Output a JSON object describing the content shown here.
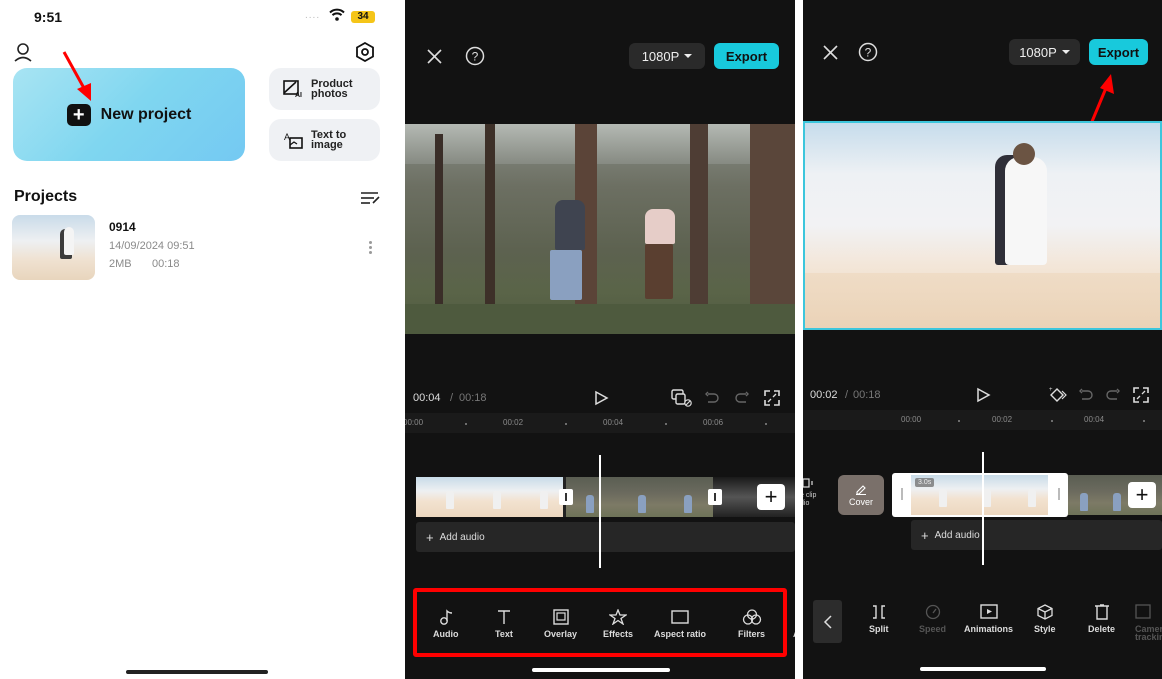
{
  "home": {
    "status_bar": {
      "time": "9:51",
      "signal": "....",
      "battery": "34"
    },
    "new_project_label": "New project",
    "side_cards": [
      {
        "label_line1": "Product",
        "label_line2": "photos",
        "icon": "ai-image-icon"
      },
      {
        "label_line1": "Text to",
        "label_line2": "image",
        "icon": "text-to-image-icon"
      }
    ],
    "projects_title": "Projects",
    "projects": [
      {
        "name": "0914",
        "date": "14/09/2024 09:51",
        "size": "2MB",
        "duration": "00:18"
      }
    ]
  },
  "editor": {
    "resolution": "1080P",
    "export_label": "Export",
    "current_time": "00:04",
    "separator": "/",
    "total_time": "00:18",
    "ruler_ticks": [
      "00:00",
      "00:02",
      "00:04",
      "00:06"
    ],
    "add_audio_label": "Add audio",
    "toolbar": [
      {
        "label": "Audio",
        "icon": "music-note-icon"
      },
      {
        "label": "Text",
        "icon": "text-icon"
      },
      {
        "label": "Overlay",
        "icon": "overlay-icon"
      },
      {
        "label": "Effects",
        "icon": "effects-star-icon"
      },
      {
        "label": "Aspect ratio",
        "icon": "aspect-ratio-icon"
      },
      {
        "label": "Filters",
        "icon": "filters-icon"
      },
      {
        "label": "A",
        "icon": ""
      }
    ]
  },
  "clip_editor": {
    "resolution": "1080P",
    "export_label": "Export",
    "current_time": "00:02",
    "separator": "/",
    "total_time": "00:18",
    "ruler_ticks": [
      "00:00",
      "00:02",
      "00:04"
    ],
    "mute_label_line1": "e clip",
    "mute_label_line2": "dio",
    "cover_label": "Cover",
    "clip_duration_badge": "3.0s",
    "add_audio_label": "Add audio",
    "toolbar": [
      {
        "label": "Split",
        "icon": "split-icon",
        "enabled": true
      },
      {
        "label": "Speed",
        "icon": "speed-icon",
        "enabled": false
      },
      {
        "label": "Animations",
        "icon": "animations-icon",
        "enabled": true
      },
      {
        "label": "Style",
        "icon": "style-cube-icon",
        "enabled": true
      },
      {
        "label": "Delete",
        "icon": "delete-icon",
        "enabled": true
      },
      {
        "label": "Camera tracking",
        "label_line1": "Camer",
        "label_line2": "trackin",
        "icon": "camera-tracking-icon",
        "enabled": false
      }
    ]
  },
  "colors": {
    "accent_export": "#18c9dc",
    "annotation_red": "#ff0000",
    "dark_bg": "#121212",
    "selection_border": "#3cc6dc"
  }
}
